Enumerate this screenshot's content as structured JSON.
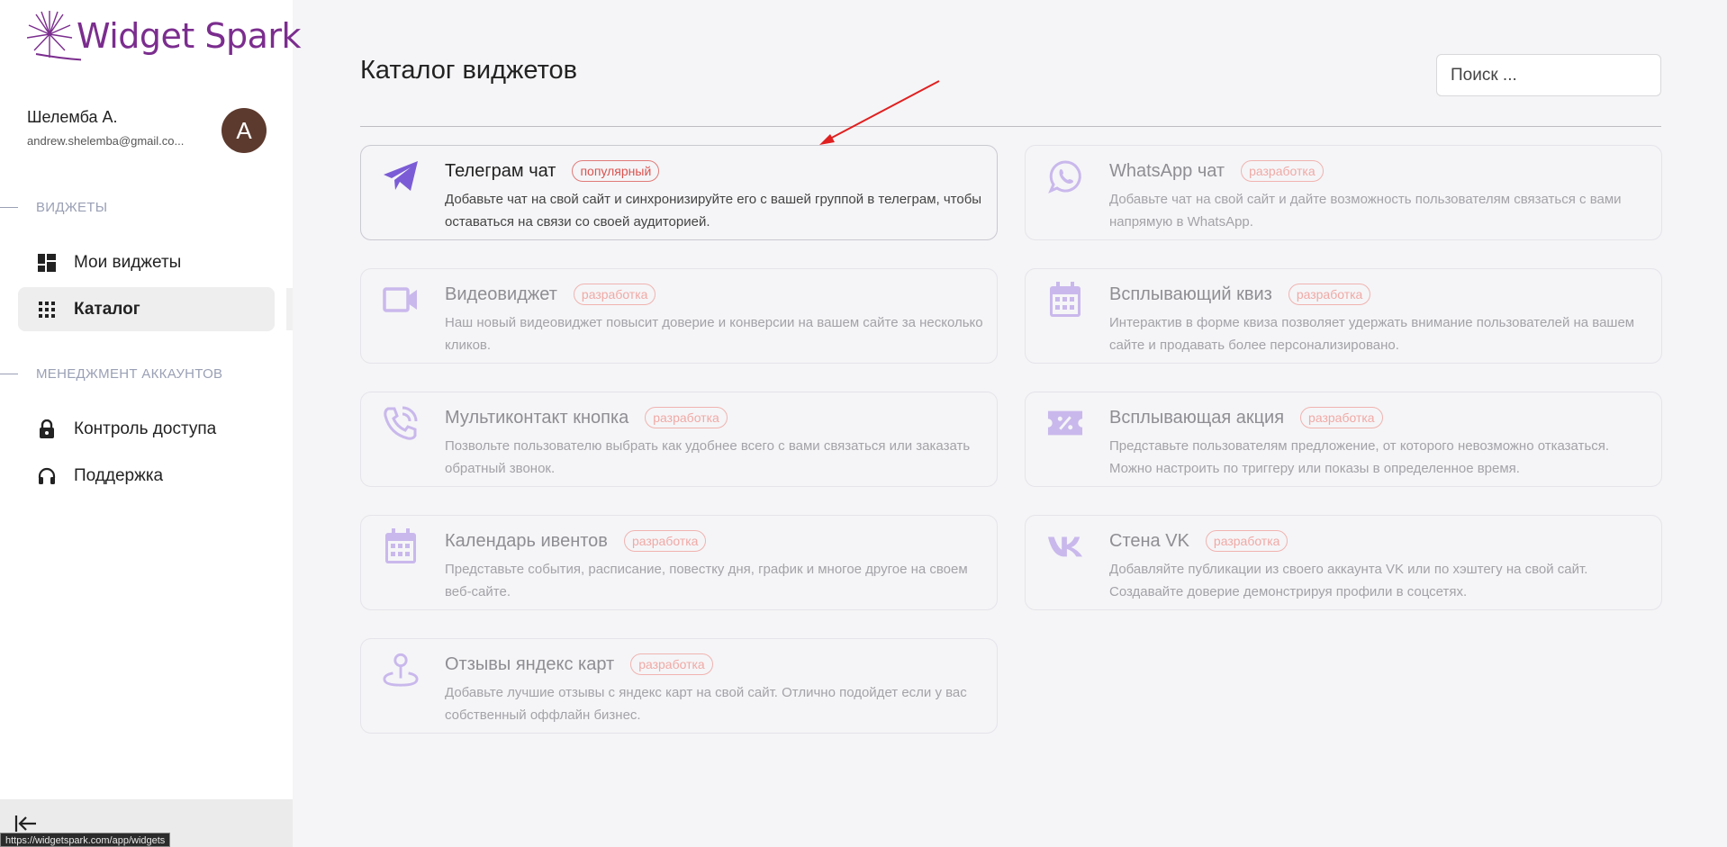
{
  "brand": {
    "name": "Widget Spark"
  },
  "user": {
    "name": "Шелемба А.",
    "email": "andrew.shelemba@gmail.co...",
    "initial": "A"
  },
  "sidebar": {
    "sections": [
      {
        "title": "ВИДЖЕТЫ"
      },
      {
        "title": "МЕНЕДЖМЕНТ АККАУНТОВ"
      }
    ],
    "items": [
      {
        "label": "Мои виджеты",
        "icon": "dashboard-icon"
      },
      {
        "label": "Каталог",
        "icon": "apps-grid-icon",
        "active": true
      },
      {
        "label": "Контроль доступа",
        "icon": "lock-icon"
      },
      {
        "label": "Поддержка",
        "icon": "headset-icon"
      }
    ]
  },
  "status_url": "https://widgetspark.com/app/widgets",
  "main": {
    "title": "Каталог виджетов",
    "search": {
      "placeholder": "Поиск ...",
      "value": ""
    }
  },
  "colors": {
    "accent": "#7b5cd6",
    "icon_muted": "#c9b8ec",
    "badge_red": "#d9534f",
    "arrow": "#e02020"
  },
  "widgets": [
    {
      "title": "Телеграм чат",
      "badge": "популярный",
      "enabled": true,
      "icon": "telegram-icon",
      "desc": "Добавьте чат на свой сайт и синхронизируйте его с вашей группой в телеграм, чтобы оставаться на связи со своей аудиторией."
    },
    {
      "title": "WhatsApp чат",
      "badge": "разработка",
      "enabled": false,
      "icon": "whatsapp-icon",
      "desc": "Добавьте чат на свой сайт и дайте возможность пользователям связаться с вами напрямую в WhatsApp."
    },
    {
      "title": "Видеовиджет",
      "badge": "разработка",
      "enabled": false,
      "icon": "video-camera-icon",
      "desc": "Наш новый видеовиджет повысит доверие и конверсии на вашем сайте за несколько кликов."
    },
    {
      "title": "Всплывающий квиз",
      "badge": "разработка",
      "enabled": false,
      "icon": "calendar-icon",
      "desc": "Интерактив в форме квиза позволяет удержать внимание пользователей на вашем сайте и продавать более персонализировано."
    },
    {
      "title": "Мультиконтакт кнопка",
      "badge": "разработка",
      "enabled": false,
      "icon": "phone-callback-icon",
      "desc": "Позвольте пользователю выбрать как удобнее всего с вами связаться или заказать обратный звонок."
    },
    {
      "title": "Всплывающая акция",
      "badge": "разработка",
      "enabled": false,
      "icon": "discount-ticket-icon",
      "desc": "Представьте пользователям предложение, от которого невозможно отказаться. Можно настроить по триггеру или показы в определенное время."
    },
    {
      "title": "Календарь ивентов",
      "badge": "разработка",
      "enabled": false,
      "icon": "calendar-icon",
      "desc": "Представьте события, расписание, повестку дня, график и многое другое на своем веб-сайте."
    },
    {
      "title": "Стена VK",
      "badge": "разработка",
      "enabled": false,
      "icon": "vk-icon",
      "desc": "Добавляйте публикации из своего аккаунта VK или по хэштегу на свой сайт. Создавайте доверие демонстрируя профили в соцсетях."
    },
    {
      "title": "Отзывы яндекс карт",
      "badge": "разработка",
      "enabled": false,
      "icon": "map-pin-icon",
      "desc": "Добавьте лучшие отзывы с яндекс карт на свой сайт. Отлично подойдет если у вас собственный оффлайн бизнес."
    }
  ]
}
